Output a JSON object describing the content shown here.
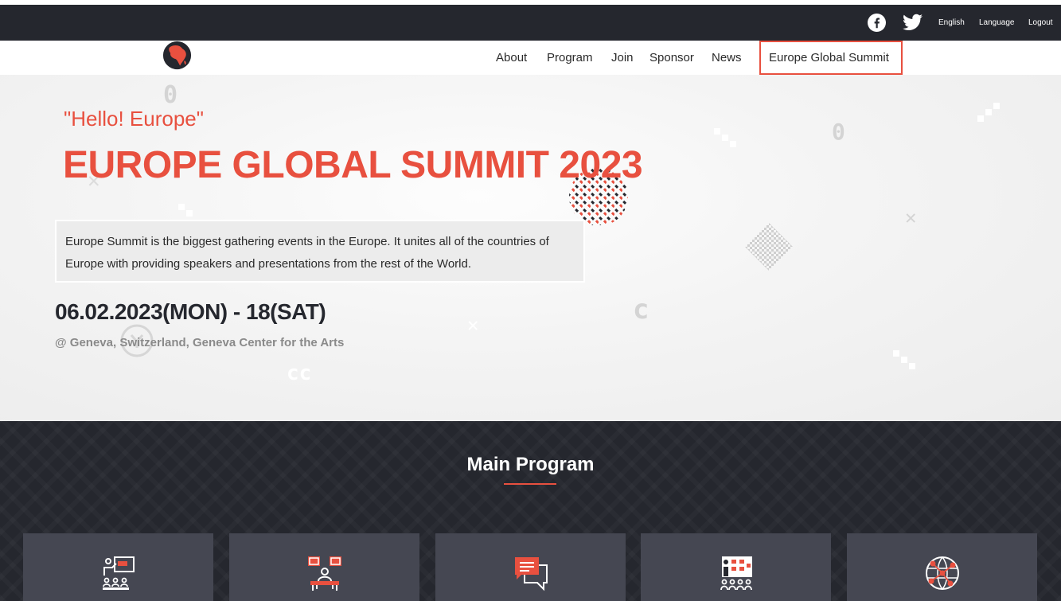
{
  "topbar": {
    "social": [
      "facebook-icon",
      "twitter-icon"
    ],
    "english": "English",
    "language": "Language",
    "logout": "Logout"
  },
  "nav": {
    "items": [
      "About",
      "Program",
      "Join",
      "Sponsor",
      "News"
    ],
    "active": "Europe Global Summit"
  },
  "hero": {
    "greeting": "\"Hello! Europe\"",
    "title": "EUROPE GLOBAL SUMMIT 2023",
    "description": "Europe Summit is the biggest gathering events in the Europe. It unites all of the countries of Europe with providing speakers and presentations from the rest of the World.",
    "date": "06.02.2023(MON) - 18(SAT)",
    "location": "@ Geneva, Switzerland, Geneva Center for the Arts"
  },
  "program": {
    "title": "Main Program",
    "cards": [
      "presentation-icon",
      "exhibition-icon",
      "discussion-icon",
      "workshop-icon",
      "network-icon"
    ]
  },
  "colors": {
    "accent": "#e8503f",
    "dark": "#25272e",
    "card": "#454752"
  }
}
